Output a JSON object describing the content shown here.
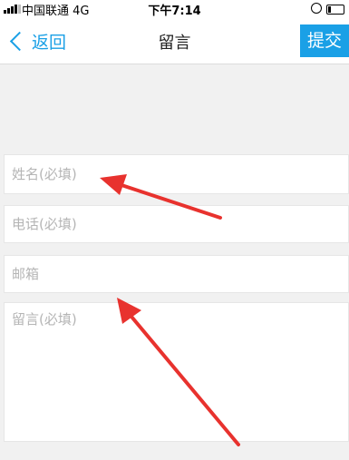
{
  "status_bar": {
    "carrier": "中国联通  4G",
    "time": "下午7:14",
    "signal_bars_filled": 4,
    "battery_level": 0.2
  },
  "nav": {
    "back_label": "返回",
    "title": "留言",
    "submit_label": "提交"
  },
  "form": {
    "name_placeholder": "姓名(必填)",
    "phone_placeholder": "电话(必填)",
    "email_placeholder": "邮箱",
    "message_placeholder": "留言(必填)"
  },
  "colors": {
    "accent": "#1aa0e6",
    "background": "#f1f1f1",
    "annotation_arrow": "#e8322e"
  },
  "icons": [
    "signal-icon",
    "orientation-lock-icon",
    "battery-icon",
    "chevron-left-icon",
    "annotation-arrow"
  ]
}
